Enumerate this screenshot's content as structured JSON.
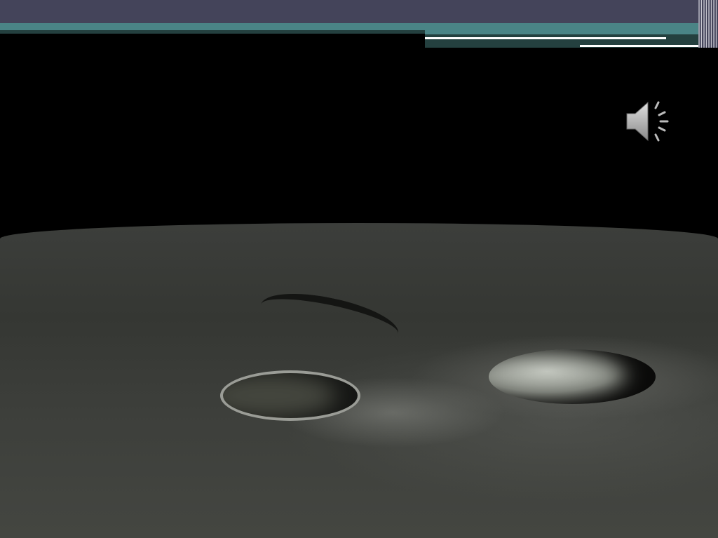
{
  "slide": {
    "image": "lunar-surface-craters",
    "audio_icon": "speaker-icon",
    "colors": {
      "header": "#44445a",
      "accent": "#4a8486",
      "accent_dark": "#24403f"
    }
  }
}
